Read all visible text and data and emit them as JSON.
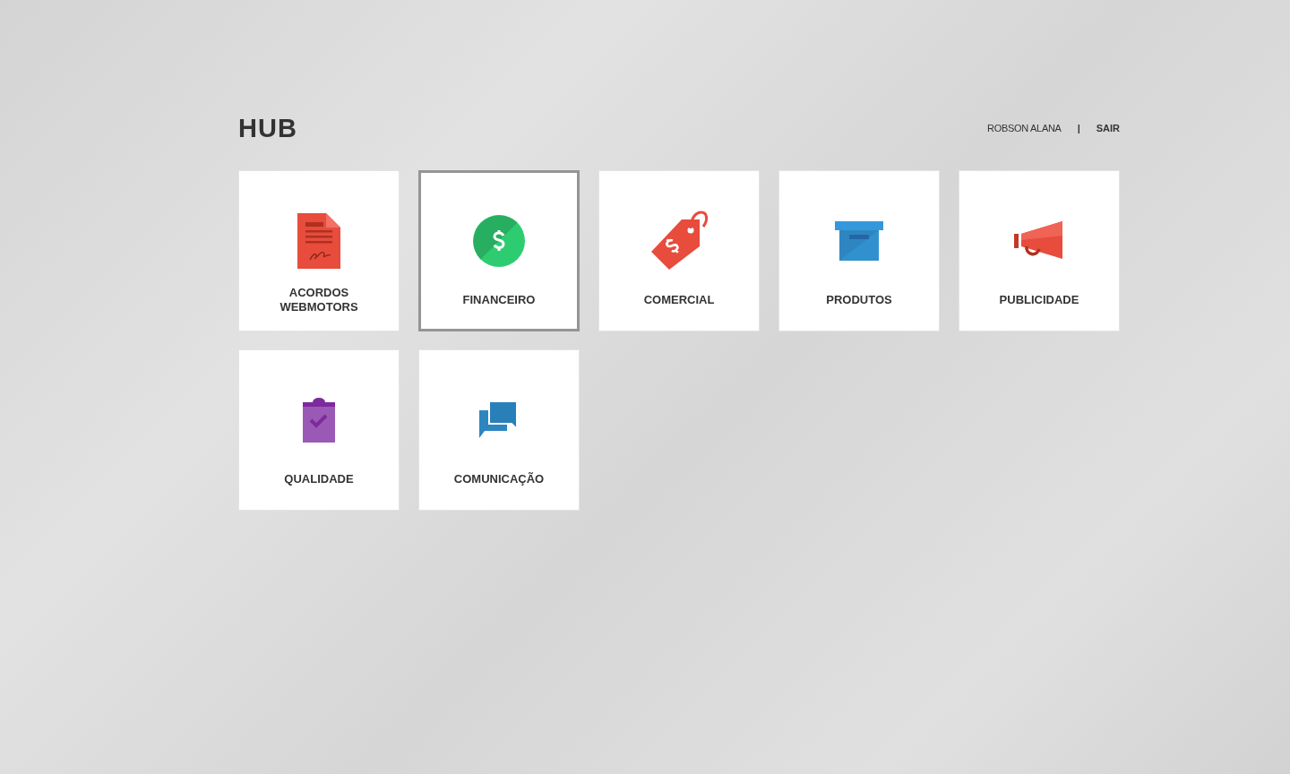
{
  "header": {
    "logo": "HUB",
    "user": "ROBSON ALANA",
    "separator": "|",
    "logout": "SAIR"
  },
  "tiles": [
    {
      "label": "ACORDOS WEBMOTORS",
      "kind": "document",
      "selected": false
    },
    {
      "label": "FINANCEIRO",
      "kind": "coin",
      "selected": true
    },
    {
      "label": "COMERCIAL",
      "kind": "tag",
      "selected": false
    },
    {
      "label": "PRODUTOS",
      "kind": "box",
      "selected": false
    },
    {
      "label": "PUBLICIDADE",
      "kind": "megaphone",
      "selected": false
    },
    {
      "label": "QUALIDADE",
      "kind": "clipboard",
      "selected": false
    },
    {
      "label": "COMUNICAÇÃO",
      "kind": "chat",
      "selected": false
    }
  ]
}
